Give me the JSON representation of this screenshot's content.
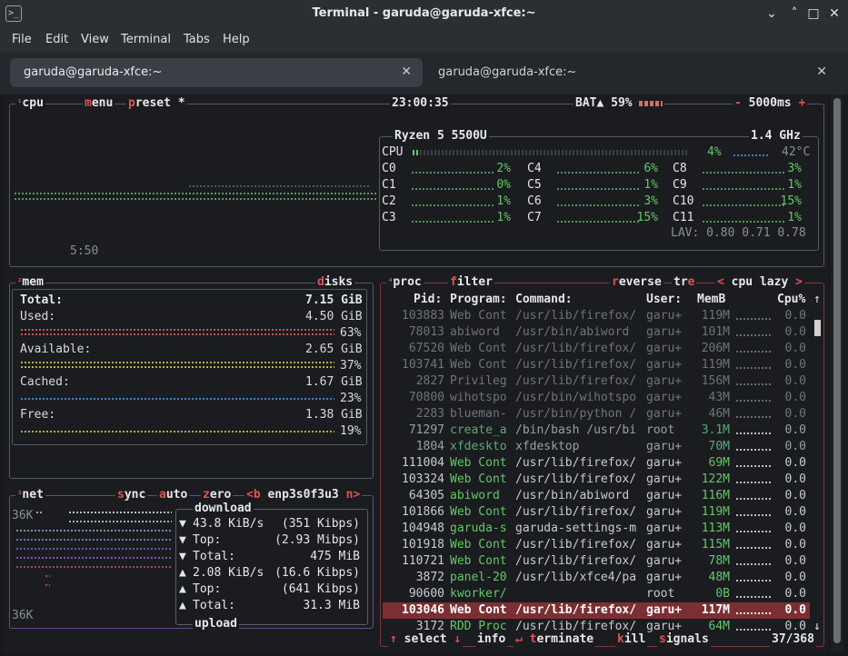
{
  "window": {
    "title": "Terminal - garuda@garuda-xfce:~",
    "minimize": "⌄",
    "restore": "˄",
    "maximize": "□",
    "close": "✕"
  },
  "menu": [
    "File",
    "Edit",
    "View",
    "Terminal",
    "Tabs",
    "Help"
  ],
  "tabs": [
    {
      "label": "garuda@garuda-xfce:~",
      "close": "✕"
    },
    {
      "label": "garuda@garuda-xfce:~",
      "close": "✕"
    }
  ],
  "cpu_box": {
    "num": "¹",
    "label": "cpu",
    "menu_h": "m",
    "menu_r": "enu",
    "preset_h": "p",
    "preset_r": "reset",
    "preset_star": "*",
    "clock": "23:00:35",
    "battery": {
      "label": "BAT▲",
      "percent": "59%",
      "level": 0.59
    },
    "update": "5000ms",
    "minus": "-",
    "plus": "+",
    "graph_time": "5:50",
    "model": "Ryzen 5 5500U",
    "freq": "1.4 GHz",
    "total": {
      "label": "CPU",
      "percent": "4%",
      "temp": "42°C"
    },
    "cores": [
      {
        "label": "C0",
        "percent": "2%"
      },
      {
        "label": "C1",
        "percent": "0%"
      },
      {
        "label": "C2",
        "percent": "1%"
      },
      {
        "label": "C3",
        "percent": "1%"
      },
      {
        "label": "C4",
        "percent": "6%"
      },
      {
        "label": "C5",
        "percent": "1%"
      },
      {
        "label": "C6",
        "percent": "3%"
      },
      {
        "label": "C7",
        "percent": "15%"
      },
      {
        "label": "C8",
        "percent": "3%"
      },
      {
        "label": "C9",
        "percent": "1%"
      },
      {
        "label": "C10",
        "percent": "15%"
      },
      {
        "label": "C11",
        "percent": "1%"
      }
    ],
    "lav": "LAV: 0.80 0.71 0.78"
  },
  "mem_box": {
    "num": "²",
    "label": "mem",
    "disks_h": "d",
    "disks_r": "isks",
    "total": {
      "label": "Total:",
      "value": "7.15 GiB"
    },
    "used": {
      "label": "Used:",
      "value": "4.50 GiB",
      "percent": "63%"
    },
    "available": {
      "label": "Available:",
      "value": "2.65 GiB",
      "percent": "37%"
    },
    "cached": {
      "label": "Cached:",
      "value": "1.67 GiB",
      "percent": "23%"
    },
    "free": {
      "label": "Free:",
      "value": "1.38 GiB",
      "percent": "19%"
    }
  },
  "net_box": {
    "num": "³",
    "label": "net",
    "sync_h": "s",
    "sync_r": "ync",
    "auto_h": "a",
    "auto_r": "uto",
    "zero_h": "z",
    "zero_r": "ero",
    "iface_prev": "<b",
    "iface": "enp3s0f3u3",
    "iface_next": "n>",
    "scale_top": "36K",
    "scale_bottom": "36K",
    "download_title": "download",
    "upload_title": "upload",
    "rows": [
      {
        "icon": "▼",
        "label": "43.8 KiB/s",
        "value": "(351 Kibps)"
      },
      {
        "icon": "▼",
        "label": "Top:",
        "value": "(2.93 Mibps)"
      },
      {
        "icon": "▼",
        "label": "Total:",
        "value": "475 MiB"
      },
      {
        "icon": "▲",
        "label": "2.08 KiB/s",
        "value": "(16.6 Kibps)"
      },
      {
        "icon": "▲",
        "label": "Top:",
        "value": "(641 Kibps)"
      },
      {
        "icon": "▲",
        "label": "Total:",
        "value": "31.3 MiB"
      }
    ]
  },
  "proc_box": {
    "num": "⁴",
    "label": "proc",
    "filter_h": "f",
    "filter_r": "ilter",
    "reverse_h": "r",
    "reverse_r": "everse",
    "tree_a": "tr",
    "tree_h": "e",
    "tree_b": "e",
    "sort_prev": "<",
    "sort": "cpu lazy",
    "sort_next": ">",
    "columns": {
      "pid": "Pid:",
      "program": "Program:",
      "command": "Command:",
      "user": "User:",
      "mem": "MemB",
      "cpu": "Cpu%",
      "arrow": "↑"
    },
    "rows": [
      {
        "pid": "103883",
        "program": "Web Cont",
        "command": "/usr/lib/firefox/",
        "user": "garu+",
        "mem": "119M",
        "cpu": "0.0",
        "style": "grey"
      },
      {
        "pid": "78013",
        "program": "abiword",
        "command": "/usr/bin/abiword",
        "user": "garu+",
        "mem": "101M",
        "cpu": "0.0",
        "style": "grey"
      },
      {
        "pid": "67520",
        "program": "Web Cont",
        "command": "/usr/lib/firefox/",
        "user": "garu+",
        "mem": "206M",
        "cpu": "0.0",
        "style": "grey"
      },
      {
        "pid": "103741",
        "program": "Web Cont",
        "command": "/usr/lib/firefox/",
        "user": "garu+",
        "mem": "119M",
        "cpu": "0.0",
        "style": "grey"
      },
      {
        "pid": "2827",
        "program": "Privileg",
        "command": "/usr/lib/firefox/",
        "user": "garu+",
        "mem": "156M",
        "cpu": "0.0",
        "style": "grey"
      },
      {
        "pid": "70800",
        "program": "wihotspo",
        "command": "/usr/bin/wihotspo",
        "user": "garu+",
        "mem": "43M",
        "cpu": "0.0",
        "style": "grey"
      },
      {
        "pid": "2283",
        "program": "blueman-",
        "command": "/usr/bin/python /",
        "user": "garu+",
        "mem": "46M",
        "cpu": "0.0",
        "style": "grey"
      },
      {
        "pid": "71297",
        "program": "create_a",
        "command": "/bin/bash /usr/bi",
        "user": "root",
        "mem": "3.1M",
        "cpu": "0.0",
        "style": "mid"
      },
      {
        "pid": "1804",
        "program": "xfdeskto",
        "command": "xfdesktop",
        "user": "garu+",
        "mem": "70M",
        "cpu": "0.0",
        "style": "mid"
      },
      {
        "pid": "111004",
        "program": "Web Cont",
        "command": "/usr/lib/firefox/",
        "user": "garu+",
        "mem": "69M",
        "cpu": "0.0",
        "style": "bright"
      },
      {
        "pid": "103324",
        "program": "Web Cont",
        "command": "/usr/lib/firefox/",
        "user": "garu+",
        "mem": "122M",
        "cpu": "0.0",
        "style": "bright"
      },
      {
        "pid": "64305",
        "program": "abiword",
        "command": "/usr/bin/abiword",
        "user": "garu+",
        "mem": "116M",
        "cpu": "0.0",
        "style": "bright"
      },
      {
        "pid": "101866",
        "program": "Web Cont",
        "command": "/usr/lib/firefox/",
        "user": "garu+",
        "mem": "119M",
        "cpu": "0.0",
        "style": "bright"
      },
      {
        "pid": "104948",
        "program": "garuda-s",
        "command": "garuda-settings-m",
        "user": "garu+",
        "mem": "113M",
        "cpu": "0.0",
        "style": "bright"
      },
      {
        "pid": "101918",
        "program": "Web Cont",
        "command": "/usr/lib/firefox/",
        "user": "garu+",
        "mem": "115M",
        "cpu": "0.0",
        "style": "bright"
      },
      {
        "pid": "110721",
        "program": "Web Cont",
        "command": "/usr/lib/firefox/",
        "user": "garu+",
        "mem": "78M",
        "cpu": "0.0",
        "style": "bright"
      },
      {
        "pid": "3872",
        "program": "panel-20",
        "command": "/usr/lib/xfce4/pa",
        "user": "garu+",
        "mem": "48M",
        "cpu": "0.0",
        "style": "bright"
      },
      {
        "pid": "90600",
        "program": "kworker/",
        "command": "",
        "user": "root",
        "mem": "0B",
        "cpu": "0.0",
        "style": "bright"
      },
      {
        "pid": "103046",
        "program": "Web Cont",
        "command": "/usr/lib/firefox/",
        "user": "garu+",
        "mem": "117M",
        "cpu": "0.0",
        "style": "selected"
      },
      {
        "pid": "3172",
        "program": "RDD Proc",
        "command": "/usr/lib/firefox/",
        "user": "garu+",
        "mem": "64M",
        "cpu": "0.0",
        "style": "bright"
      }
    ],
    "scroll_down": "↓",
    "footer": {
      "select_h": "↑",
      "select": "select",
      "info_h": "↓",
      "info": "info",
      "terminate_h": "↵",
      "terminate_r": "erminate",
      "terminate_t": "t",
      "kill_h": "k",
      "kill_r": "ill",
      "signals_h": "s",
      "signals_r": "ignals",
      "count": "37/368"
    }
  },
  "colors": {
    "accent": "#e05252",
    "green": "#64c866",
    "teal": "#6fc1a8",
    "selected_row": "#7b2f33",
    "border": "#555a61"
  }
}
